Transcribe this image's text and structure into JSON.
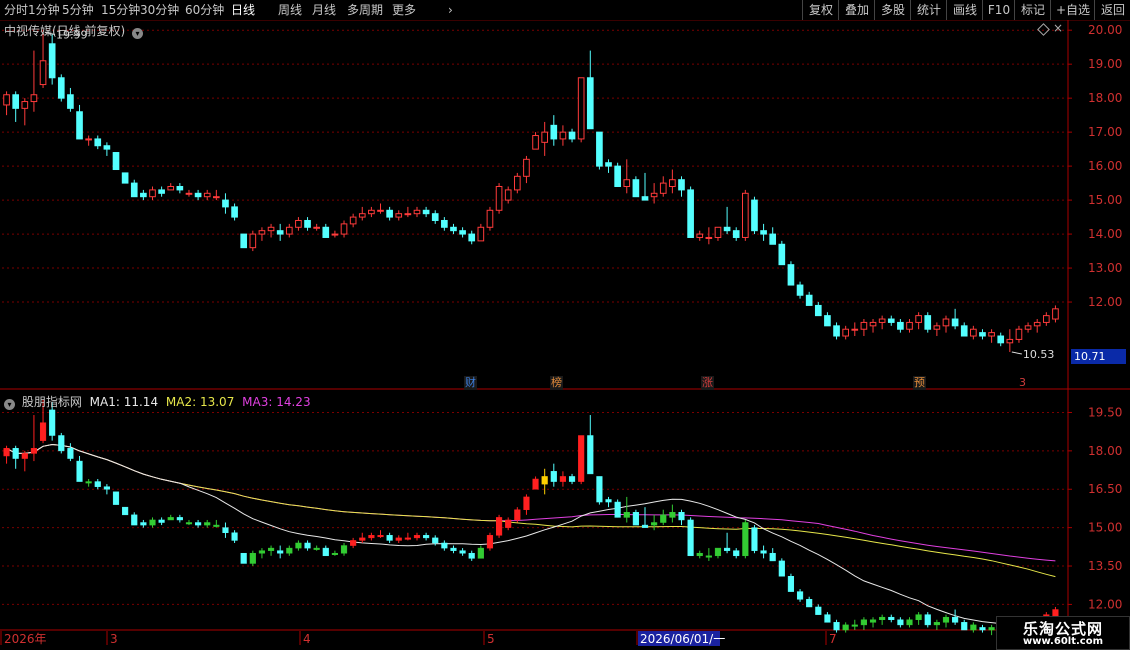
{
  "toolbar": {
    "periods": [
      "分时",
      "1分钟",
      "5分钟",
      "15分钟",
      "30分钟",
      "60分钟",
      "日线",
      "周线",
      "月线",
      "多周期",
      "更多"
    ],
    "active_period": "日线",
    "more_icon": "chevron-right-icon",
    "right_buttons": [
      "复权",
      "叠加",
      "多股",
      "统计",
      "画线",
      "F10",
      "标记",
      "+自选",
      "返回"
    ]
  },
  "price_panel": {
    "title": "中视传媒(日线 前复权)",
    "title_icon": "chevron-down-circle-icon",
    "diamond_icon": "diamond-icon",
    "y_ticks": [
      "20.00",
      "19.00",
      "18.00",
      "17.00",
      "16.00",
      "15.00",
      "14.00",
      "13.00",
      "12.00"
    ],
    "current_price": "10.71",
    "high_label": "19.99",
    "low_label": "10.53",
    "event_tags": [
      {
        "text": "财",
        "color": "#3b7ddd"
      },
      {
        "text": "榜",
        "color": "#e08a3a"
      },
      {
        "text": "涨",
        "color": "#d33c3c"
      },
      {
        "text": "预",
        "color": "#e08a3a"
      },
      {
        "text": "3",
        "color": "#d33c3c"
      }
    ]
  },
  "indicator_panel": {
    "title": "股朋指标网",
    "title_icon": "chevron-down-circle-icon",
    "ma1_label": "MA1: 11.14",
    "ma2_label": "MA2: 13.07",
    "ma3_label": "MA3: 14.23",
    "y_ticks": [
      "19.50",
      "18.00",
      "16.50",
      "15.00",
      "13.50",
      "12.00"
    ]
  },
  "x_axis": {
    "labels": [
      "2026年",
      "3",
      "4",
      "5",
      "2026/06/01/一",
      "7"
    ]
  },
  "watermark": {
    "title": "乐淘公式网",
    "url": "www.60lt.com"
  },
  "colors": {
    "up": "#ff3b3b",
    "down": "#54ffff",
    "ma_white": "#e8e8e8",
    "ma_yellow": "#e6e64a",
    "ma_magenta": "#e040e0",
    "grid": "#7a0000",
    "axis_text": "#d03030",
    "title": "#c8c8c8",
    "ind_up": "#ff2020",
    "ind_green": "#33cc33",
    "ind_cyan": "#54ffff",
    "ind_yellow": "#ffd000"
  },
  "chart_data": {
    "type": "candlestick",
    "x_labels": [
      "2026年",
      "3",
      "4",
      "5",
      "2026/06/01/一",
      "7"
    ],
    "price_high": 19.99,
    "price_low": 10.53,
    "last_close": 10.71,
    "ylim": [
      10.0,
      20.3
    ],
    "ind_ylim": [
      11.0,
      20.3
    ],
    "ma": {
      "MA1": 11.14,
      "MA2": 13.07,
      "MA3": 14.23
    },
    "candles": [
      [
        17.8,
        18.2,
        17.5,
        18.1
      ],
      [
        18.1,
        18.2,
        17.3,
        17.7
      ],
      [
        17.7,
        18.0,
        17.2,
        17.9
      ],
      [
        17.9,
        19.4,
        17.6,
        18.1
      ],
      [
        18.4,
        19.99,
        18.3,
        19.1
      ],
      [
        19.6,
        19.9,
        18.4,
        18.6
      ],
      [
        18.6,
        18.7,
        17.9,
        18.0
      ],
      [
        18.1,
        18.3,
        17.6,
        17.7
      ],
      [
        17.6,
        17.8,
        16.8,
        16.8
      ],
      [
        16.8,
        16.9,
        16.6,
        16.8
      ],
      [
        16.8,
        16.9,
        16.5,
        16.6
      ],
      [
        16.6,
        16.7,
        16.3,
        16.5
      ],
      [
        16.4,
        16.4,
        15.9,
        15.9
      ],
      [
        15.8,
        15.8,
        15.5,
        15.5
      ],
      [
        15.5,
        15.6,
        15.1,
        15.1
      ],
      [
        15.2,
        15.3,
        15.0,
        15.1
      ],
      [
        15.1,
        15.4,
        15.0,
        15.3
      ],
      [
        15.3,
        15.4,
        15.1,
        15.2
      ],
      [
        15.3,
        15.5,
        15.3,
        15.4
      ],
      [
        15.4,
        15.5,
        15.2,
        15.3
      ],
      [
        15.2,
        15.3,
        15.1,
        15.2
      ],
      [
        15.2,
        15.3,
        15.0,
        15.1
      ],
      [
        15.1,
        15.3,
        15.0,
        15.2
      ],
      [
        15.1,
        15.3,
        15.0,
        15.1
      ],
      [
        15.0,
        15.2,
        14.6,
        14.8
      ],
      [
        14.8,
        14.9,
        14.4,
        14.5
      ],
      [
        14.0,
        14.0,
        13.6,
        13.6
      ],
      [
        13.6,
        14.1,
        13.5,
        14.0
      ],
      [
        14.0,
        14.2,
        13.8,
        14.1
      ],
      [
        14.1,
        14.3,
        13.9,
        14.2
      ],
      [
        14.1,
        14.3,
        13.8,
        14.0
      ],
      [
        14.0,
        14.3,
        13.9,
        14.2
      ],
      [
        14.2,
        14.5,
        14.1,
        14.4
      ],
      [
        14.4,
        14.5,
        14.1,
        14.2
      ],
      [
        14.2,
        14.3,
        14.1,
        14.2
      ],
      [
        14.2,
        14.3,
        13.9,
        13.9
      ],
      [
        14.0,
        14.1,
        13.9,
        14.0
      ],
      [
        14.0,
        14.4,
        13.9,
        14.3
      ],
      [
        14.3,
        14.6,
        14.2,
        14.5
      ],
      [
        14.5,
        14.8,
        14.4,
        14.6
      ],
      [
        14.6,
        14.8,
        14.5,
        14.7
      ],
      [
        14.7,
        14.9,
        14.6,
        14.7
      ],
      [
        14.7,
        14.8,
        14.4,
        14.5
      ],
      [
        14.5,
        14.7,
        14.4,
        14.6
      ],
      [
        14.6,
        14.8,
        14.5,
        14.6
      ],
      [
        14.6,
        14.8,
        14.5,
        14.7
      ],
      [
        14.7,
        14.8,
        14.5,
        14.6
      ],
      [
        14.6,
        14.7,
        14.3,
        14.4
      ],
      [
        14.4,
        14.5,
        14.1,
        14.2
      ],
      [
        14.2,
        14.3,
        14.0,
        14.1
      ],
      [
        14.1,
        14.2,
        13.9,
        14.0
      ],
      [
        14.0,
        14.1,
        13.7,
        13.8
      ],
      [
        13.8,
        14.3,
        13.8,
        14.2
      ],
      [
        14.2,
        14.8,
        14.1,
        14.7
      ],
      [
        14.7,
        15.5,
        14.6,
        15.4
      ],
      [
        15.0,
        15.4,
        14.9,
        15.3
      ],
      [
        15.3,
        15.8,
        15.2,
        15.7
      ],
      [
        15.7,
        16.3,
        15.5,
        16.2
      ],
      [
        16.5,
        17.0,
        16.5,
        16.9
      ],
      [
        16.7,
        17.3,
        16.3,
        17.0
      ],
      [
        17.2,
        17.5,
        16.6,
        16.8
      ],
      [
        16.8,
        17.2,
        16.6,
        17.0
      ],
      [
        17.0,
        17.1,
        16.7,
        16.8
      ],
      [
        16.8,
        18.6,
        16.7,
        18.6
      ],
      [
        18.6,
        19.4,
        18.0,
        17.1
      ],
      [
        17.0,
        17.0,
        15.9,
        16.0
      ],
      [
        16.1,
        16.2,
        15.8,
        16.0
      ],
      [
        16.0,
        16.1,
        15.4,
        15.4
      ],
      [
        15.4,
        16.2,
        15.2,
        15.6
      ],
      [
        15.6,
        15.7,
        15.1,
        15.1
      ],
      [
        15.1,
        15.8,
        15.0,
        15.0
      ],
      [
        15.1,
        15.5,
        14.9,
        15.2
      ],
      [
        15.2,
        15.7,
        15.1,
        15.5
      ],
      [
        15.4,
        15.9,
        15.2,
        15.6
      ],
      [
        15.6,
        15.7,
        15.1,
        15.3
      ],
      [
        15.3,
        15.4,
        13.9,
        13.9
      ],
      [
        13.9,
        14.1,
        13.8,
        14.0
      ],
      [
        13.9,
        14.2,
        13.7,
        13.9
      ],
      [
        13.9,
        14.1,
        13.8,
        14.2
      ],
      [
        14.2,
        14.8,
        14.0,
        14.1
      ],
      [
        14.1,
        14.2,
        13.8,
        13.9
      ],
      [
        13.9,
        15.3,
        13.8,
        15.2
      ],
      [
        15.0,
        15.1,
        14.0,
        14.1
      ],
      [
        14.1,
        14.3,
        13.8,
        14.0
      ],
      [
        14.0,
        14.2,
        13.7,
        13.7
      ],
      [
        13.7,
        13.8,
        13.1,
        13.1
      ],
      [
        13.1,
        13.2,
        12.5,
        12.5
      ],
      [
        12.5,
        12.6,
        12.1,
        12.2
      ],
      [
        12.2,
        12.3,
        11.9,
        11.9
      ],
      [
        11.9,
        12.0,
        11.6,
        11.6
      ],
      [
        11.6,
        11.7,
        11.3,
        11.3
      ],
      [
        11.3,
        11.4,
        10.9,
        11.0
      ],
      [
        11.0,
        11.3,
        10.9,
        11.2
      ],
      [
        11.2,
        11.4,
        11.0,
        11.2
      ],
      [
        11.2,
        11.5,
        11.0,
        11.4
      ],
      [
        11.3,
        11.5,
        11.1,
        11.4
      ],
      [
        11.4,
        11.6,
        11.2,
        11.5
      ],
      [
        11.5,
        11.6,
        11.3,
        11.4
      ],
      [
        11.4,
        11.5,
        11.1,
        11.2
      ],
      [
        11.2,
        11.5,
        11.1,
        11.4
      ],
      [
        11.4,
        11.7,
        11.2,
        11.6
      ],
      [
        11.6,
        11.7,
        11.1,
        11.2
      ],
      [
        11.2,
        11.4,
        11.0,
        11.3
      ],
      [
        11.3,
        11.6,
        11.1,
        11.5
      ],
      [
        11.5,
        11.8,
        11.2,
        11.3
      ],
      [
        11.3,
        11.4,
        11.0,
        11.0
      ],
      [
        11.0,
        11.3,
        10.9,
        11.2
      ],
      [
        11.1,
        11.2,
        10.9,
        11.0
      ],
      [
        11.0,
        11.2,
        10.8,
        11.1
      ],
      [
        11.0,
        11.1,
        10.7,
        10.8
      ],
      [
        10.8,
        11.2,
        10.53,
        10.9
      ],
      [
        10.9,
        11.3,
        10.8,
        11.2
      ],
      [
        11.2,
        11.4,
        11.1,
        11.3
      ],
      [
        11.3,
        11.5,
        11.1,
        11.4
      ],
      [
        11.4,
        11.7,
        11.3,
        11.6
      ],
      [
        11.5,
        11.9,
        11.4,
        11.8
      ]
    ]
  }
}
